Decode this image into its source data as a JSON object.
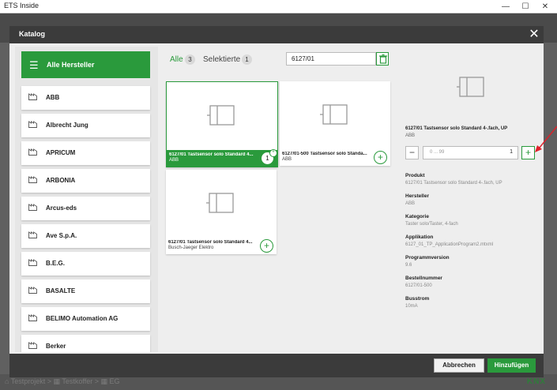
{
  "window": {
    "title": "ETS Inside",
    "minimize": "—",
    "maximize": "☐",
    "close": "✕"
  },
  "background": {
    "project_initials": "EG",
    "breadcrumb": "⌂ Testprojekt > ▦ Testkoffer > ▦ EG",
    "brand": "KNX"
  },
  "dialog": {
    "title": "Katalog",
    "close": "✕",
    "manufacturer_header": "Alle Hersteller",
    "manufacturers": [
      "ABB",
      "Albrecht Jung",
      "APRICUM",
      "ARBONIA",
      "Arcus-eds",
      "Ave S.p.A.",
      "B.E.G.",
      "BASALTE",
      "BELIMO Automation AG",
      "Berker"
    ],
    "tabs": {
      "all": "Alle",
      "all_count": "3",
      "selected": "Selektierte",
      "selected_count": "1"
    },
    "search_value": "6127/01",
    "products": [
      {
        "name": "6127/01 Tastsensor solo Standard 4...",
        "manufacturer": "ABB",
        "badge": "1",
        "selected": true
      },
      {
        "name": "6127/01-500 Tastsensor solo Standa...",
        "manufacturer": "ABB",
        "selected": false
      },
      {
        "name": "6127/01 Tastsensor solo Standard 4...",
        "manufacturer": "Busch-Jaeger Elektro",
        "selected": false
      }
    ],
    "detail": {
      "name": "6127/01 Tastsensor solo Standard 4-.fach, UP",
      "manufacturer": "ABB",
      "qty_placeholder": "0 ... 99",
      "qty_value": "1",
      "fields": [
        {
          "label": "Produkt",
          "value": "6127/01 Tastsensor solo Standard 4-.fach, UP"
        },
        {
          "label": "Hersteller",
          "value": "ABB"
        },
        {
          "label": "Kategorie",
          "value": "Taster solo/Taster, 4-fach"
        },
        {
          "label": "Applikation",
          "value": "6127_01_TP_ApplicationProgram2.mtxml"
        },
        {
          "label": "Programmversion",
          "value": "9.6"
        },
        {
          "label": "Bestellnummer",
          "value": "6127/01-500"
        },
        {
          "label": "Busstrom",
          "value": "10mA"
        }
      ]
    },
    "cancel_label": "Abbrechen",
    "add_label": "Hinzufügen"
  },
  "colors": {
    "accent": "#2a9a3c",
    "header": "#3b3b3b",
    "annotation_arrow": "#e0202a"
  }
}
